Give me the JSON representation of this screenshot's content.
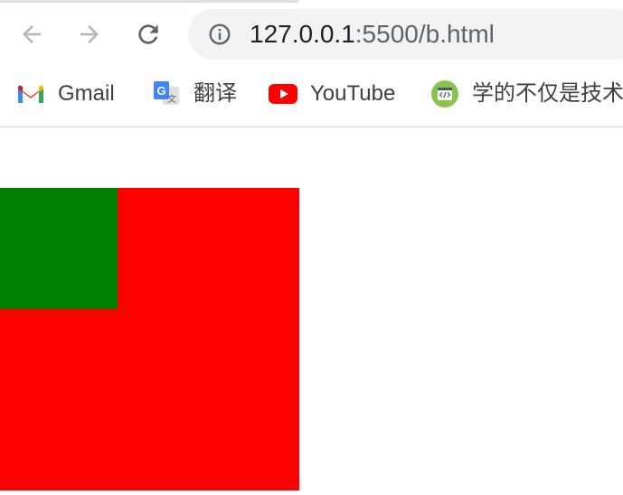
{
  "toolbar": {
    "url_host": "127.0.0.1",
    "url_rest": ":5500/b.html"
  },
  "icons": {
    "back": "back-arrow-icon",
    "forward": "forward-arrow-icon",
    "reload": "reload-icon",
    "site_info": "info-icon"
  },
  "bookmarks": [
    {
      "label": "Gmail",
      "icon": "gmail-icon"
    },
    {
      "label": "翻译",
      "icon": "google-translate-icon"
    },
    {
      "label": "YouTube",
      "icon": "youtube-icon"
    },
    {
      "label": "学的不仅是技术",
      "icon": "code-icon"
    }
  ],
  "page": {
    "outer_box_color": "#ff0000",
    "inner_box_color": "#008000"
  }
}
